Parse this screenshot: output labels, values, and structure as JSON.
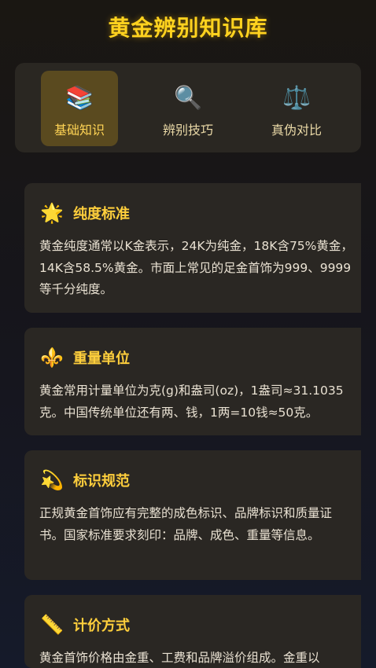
{
  "page": {
    "title": "黄金辨别知识库"
  },
  "tabs": [
    {
      "icon": "books-icon",
      "icon_glyph": "📚",
      "label": "基础知识",
      "active": true
    },
    {
      "icon": "magnifier-icon",
      "icon_glyph": "🔍",
      "label": "辨别技巧",
      "active": false
    },
    {
      "icon": "scales-icon",
      "icon_glyph": "⚖️",
      "label": "真伪对比",
      "active": false
    }
  ],
  "cards": [
    {
      "icon": "star-icon",
      "icon_glyph": "🌟",
      "title": "纯度标准",
      "body": "黄金纯度通常以K金表示，24K为纯金，18K含75%黄金，14K含58.5%黄金。市面上常见的足金首饰为999、9999等千分纯度。"
    },
    {
      "icon": "fleur-de-lis-icon",
      "icon_glyph": "⚜️",
      "title": "重量单位",
      "body": "黄金常用计量单位为克(g)和盎司(oz)，1盎司≈31.1035克。中国传统单位还有两、钱，1两=10钱≈50克。"
    },
    {
      "icon": "dizzy-star-icon",
      "icon_glyph": "💫",
      "title": "标识规范",
      "body": "正规黄金首饰应有完整的成色标识、品牌标识和质量证书。国家标准要求刻印：品牌、成色、重量等信息。"
    },
    {
      "icon": "ruler-icon",
      "icon_glyph": "📏",
      "title": "计价方式",
      "body": "黄金首饰价格由金重、工费和品牌溢价组成。金重以"
    }
  ],
  "colors": {
    "accent": "#ffd21f",
    "active_tab_bg": "#5a4a1f",
    "card_bg": "#2a2723"
  }
}
